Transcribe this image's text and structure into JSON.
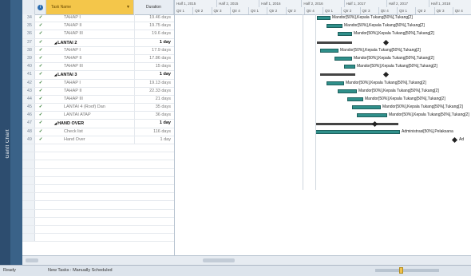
{
  "side_panel": {
    "label": "Gantt Chart"
  },
  "grid": {
    "headers": {
      "name": "Task Name",
      "duration": "Duration"
    },
    "rows": [
      {
        "id": "34",
        "check": "✓",
        "name": "TAHAP I",
        "duration": "19.46 days",
        "summary": false,
        "indent": 2
      },
      {
        "id": "35",
        "check": "✓",
        "name": "TAHAP II",
        "duration": "19.75 days",
        "summary": false,
        "indent": 2
      },
      {
        "id": "36",
        "check": "✓",
        "name": "TAHAP III",
        "duration": "19.6 days",
        "summary": false,
        "indent": 2
      },
      {
        "id": "37",
        "check": "✓",
        "name": "LANTAI 2",
        "duration": "1 day",
        "summary": true,
        "indent": 1
      },
      {
        "id": "38",
        "check": "✓",
        "name": "TAHAP I",
        "duration": "17.9 days",
        "summary": false,
        "indent": 2
      },
      {
        "id": "39",
        "check": "✓",
        "name": "TAHAP II",
        "duration": "17.86 days",
        "summary": false,
        "indent": 2
      },
      {
        "id": "40",
        "check": "✓",
        "name": "TAHAP III",
        "duration": "15 days",
        "summary": false,
        "indent": 2
      },
      {
        "id": "41",
        "check": "✓",
        "name": "LANTAI 3",
        "duration": "1 day",
        "summary": true,
        "indent": 1
      },
      {
        "id": "42",
        "check": "✓",
        "name": "TAHAP I",
        "duration": "19.13 days",
        "summary": false,
        "indent": 2
      },
      {
        "id": "43",
        "check": "✓",
        "name": "TAHAP II",
        "duration": "22.33 days",
        "summary": false,
        "indent": 2
      },
      {
        "id": "44",
        "check": "✓",
        "name": "TAHAP III",
        "duration": "21 days",
        "summary": false,
        "indent": 2
      },
      {
        "id": "45",
        "check": "✓",
        "name": "LANTAI 4 (Roof) Dan",
        "duration": "35 days",
        "summary": false,
        "indent": 2
      },
      {
        "id": "46",
        "check": "✓",
        "name": "LANTAI ATAP",
        "duration": "36 days",
        "summary": false,
        "indent": 2
      },
      {
        "id": "47",
        "check": "✓",
        "name": "HAND OVER",
        "duration": "1 day",
        "summary": true,
        "indent": 1
      },
      {
        "id": "48",
        "check": "✓",
        "name": "Check list",
        "duration": "116 days",
        "summary": false,
        "indent": 2
      },
      {
        "id": "49",
        "check": "✓",
        "name": "Hand Over",
        "duration": "1 day",
        "summary": false,
        "indent": 2
      }
    ]
  },
  "timeline": {
    "top": [
      "Half 1, 2015",
      "Half 2, 2015",
      "Half 1, 2016",
      "Half 2, 2016",
      "Half 1, 2017",
      "Half 2, 2017",
      "Half 1, 2018"
    ],
    "bottom": [
      "Qtr 1",
      "Qtr 2",
      "Qtr 3",
      "Qtr 4",
      "Qtr 1",
      "Qtr 2",
      "Qtr 3",
      "Qtr 4",
      "Qtr 1",
      "Qtr 2",
      "Qtr 3",
      "Qtr 4",
      "Qtr 1",
      "Qtr 2",
      "Qtr 3",
      "Qtr 4"
    ]
  },
  "bar_labels": [
    "Mandor[50%],Kepala Tukang[50%],Tukang[2]",
    "Mandor[50%],Kepala Tukang[50%],Tukang[2]",
    "Mandor[50%],Kepala Tukang[50%],Tukang[2]",
    "Mandor[50%],Kepala Tukang[50%],Tukang[2]",
    "Mandor[50%],Kepala Tukang[50%],Tukang[2]",
    "Mandor[50%],Kepala Tukang[50%],Tukang[2]",
    "Mandor[50%],Kepala Tukang[50%],Tukang[2]",
    "Mandor[50%],Kepala Tukang[50%],Tukang[2]",
    "Mandor[50%],Kepala Tukang[50%],Tukang[2]",
    "Mandor[50%],Kepala Tukang[50%],Tukang[2]",
    "Mandor[50%],Kepala Tukang[50%],Tukang[2]",
    "Administrasi[50%],Pelaksana",
    "Ad"
  ],
  "status_bar": {
    "left": "Ready",
    "new_tasks": "New Tasks : Manually Scheduled"
  },
  "colors": {
    "task_bar": "#2f8f8a",
    "summary_bar": "#444444",
    "header_highlight": "#f4c64a",
    "sidebar": "#2d4d6f"
  }
}
